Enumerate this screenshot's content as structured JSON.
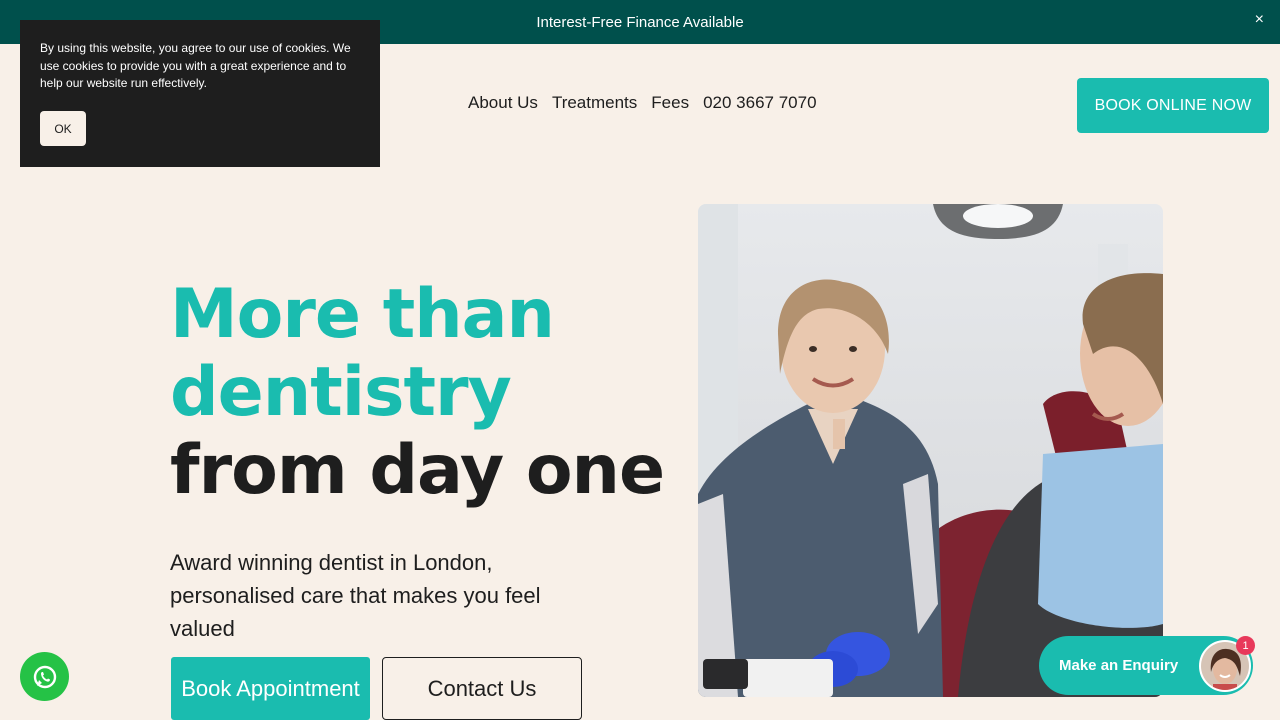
{
  "topbar": {
    "text": "Interest-Free Finance Available",
    "close": "×"
  },
  "nav": {
    "items": [
      "About Us",
      "Treatments",
      "Fees",
      "020 3667 7070"
    ],
    "cta": "BOOK ONLINE NOW"
  },
  "cookie": {
    "text": "By using this website, you agree to our use of cookies. We use cookies to provide you with a great experience and to help our website run effectively.",
    "ok": "OK"
  },
  "hero": {
    "title_line1": "More than",
    "title_line2": "dentistry",
    "title_line3": "from day one",
    "subtitle": "Award winning dentist in London, personalised care that makes you feel valued",
    "book_button": "Book Appointment",
    "contact_button": "Contact Us"
  },
  "widgets": {
    "enquiry": "Make an Enquiry",
    "notification_count": "1",
    "whatsapp_icon": "whatsapp-icon"
  },
  "colors": {
    "teal": "#1abcaf",
    "dark_teal": "#00504c",
    "background": "#f8f0e8",
    "dark": "#1e1e1e"
  }
}
